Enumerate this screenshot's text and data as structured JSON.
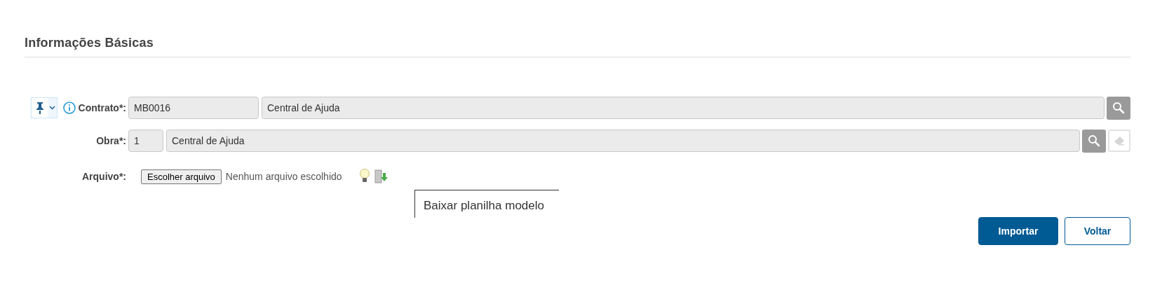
{
  "section_title": "Informações Básicas",
  "fields": [
    {
      "label": "Contrato*:",
      "code": "MB0016",
      "description": "Central de Ajuda",
      "clearable": false,
      "pinned_controls": true
    },
    {
      "label": "Obra*:",
      "code": "1",
      "description": "Central de Ajuda",
      "clearable": true,
      "pinned_controls": false
    }
  ],
  "file_field": {
    "label": "Arquivo*:",
    "button": "Escolher arquivo",
    "status": "Nenhum arquivo escolhido",
    "tooltip": "Baixar planilha modelo"
  },
  "buttons": [
    {
      "label": "Importar",
      "kind": "primary"
    },
    {
      "label": "Voltar",
      "kind": "secondary"
    }
  ]
}
